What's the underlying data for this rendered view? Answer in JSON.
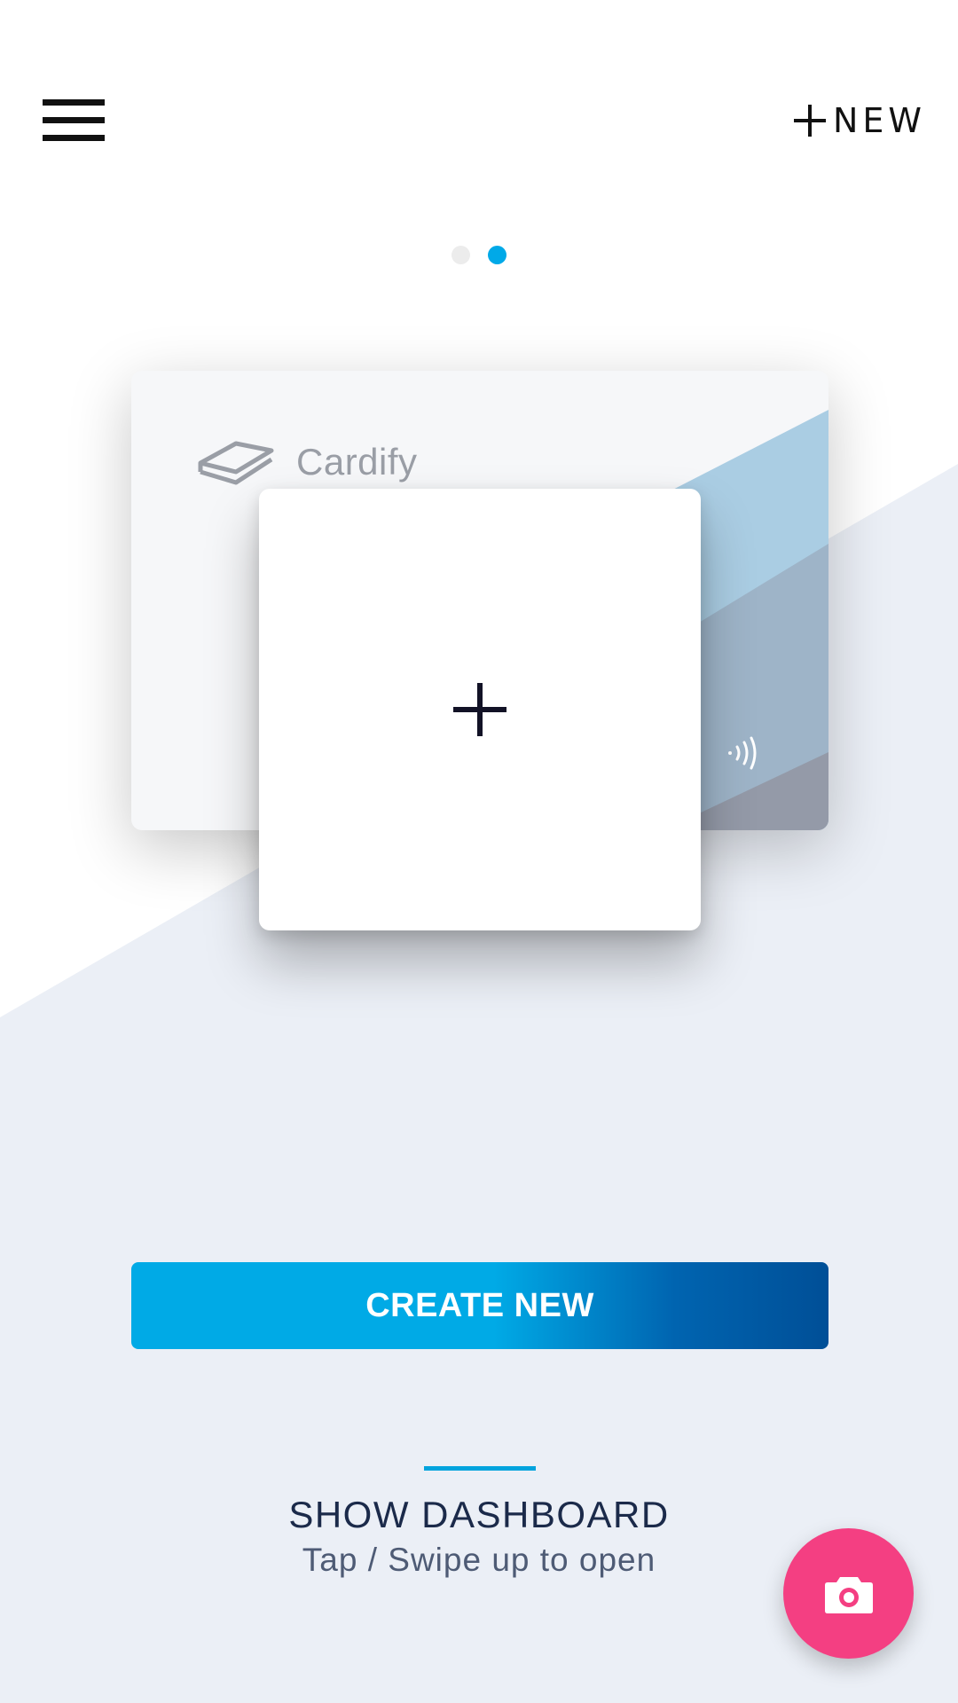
{
  "header": {
    "menu_icon": "hamburger-menu-icon",
    "new_icon": "plus-icon",
    "new_label": "NEW"
  },
  "pager": {
    "pages": 2,
    "active_page": 2,
    "active_color": "#00a9e8"
  },
  "card_preview": {
    "logo_icon": "stacked-cards-logo-icon",
    "logo_text": "Cardify",
    "contactless_icon": "contactless-icon"
  },
  "add_card": {
    "icon": "plus-icon"
  },
  "create_button": {
    "label": "CREATE NEW"
  },
  "dashboard": {
    "title": "SHOW DASHBOARD",
    "hint": "Tap / Swipe up to open"
  },
  "fab": {
    "icon": "camera-icon",
    "color": "#f43f82"
  },
  "colors": {
    "accent": "#00a9e8",
    "background_wedge": "#ebeff6",
    "button_gradient_end": "#004f97"
  }
}
